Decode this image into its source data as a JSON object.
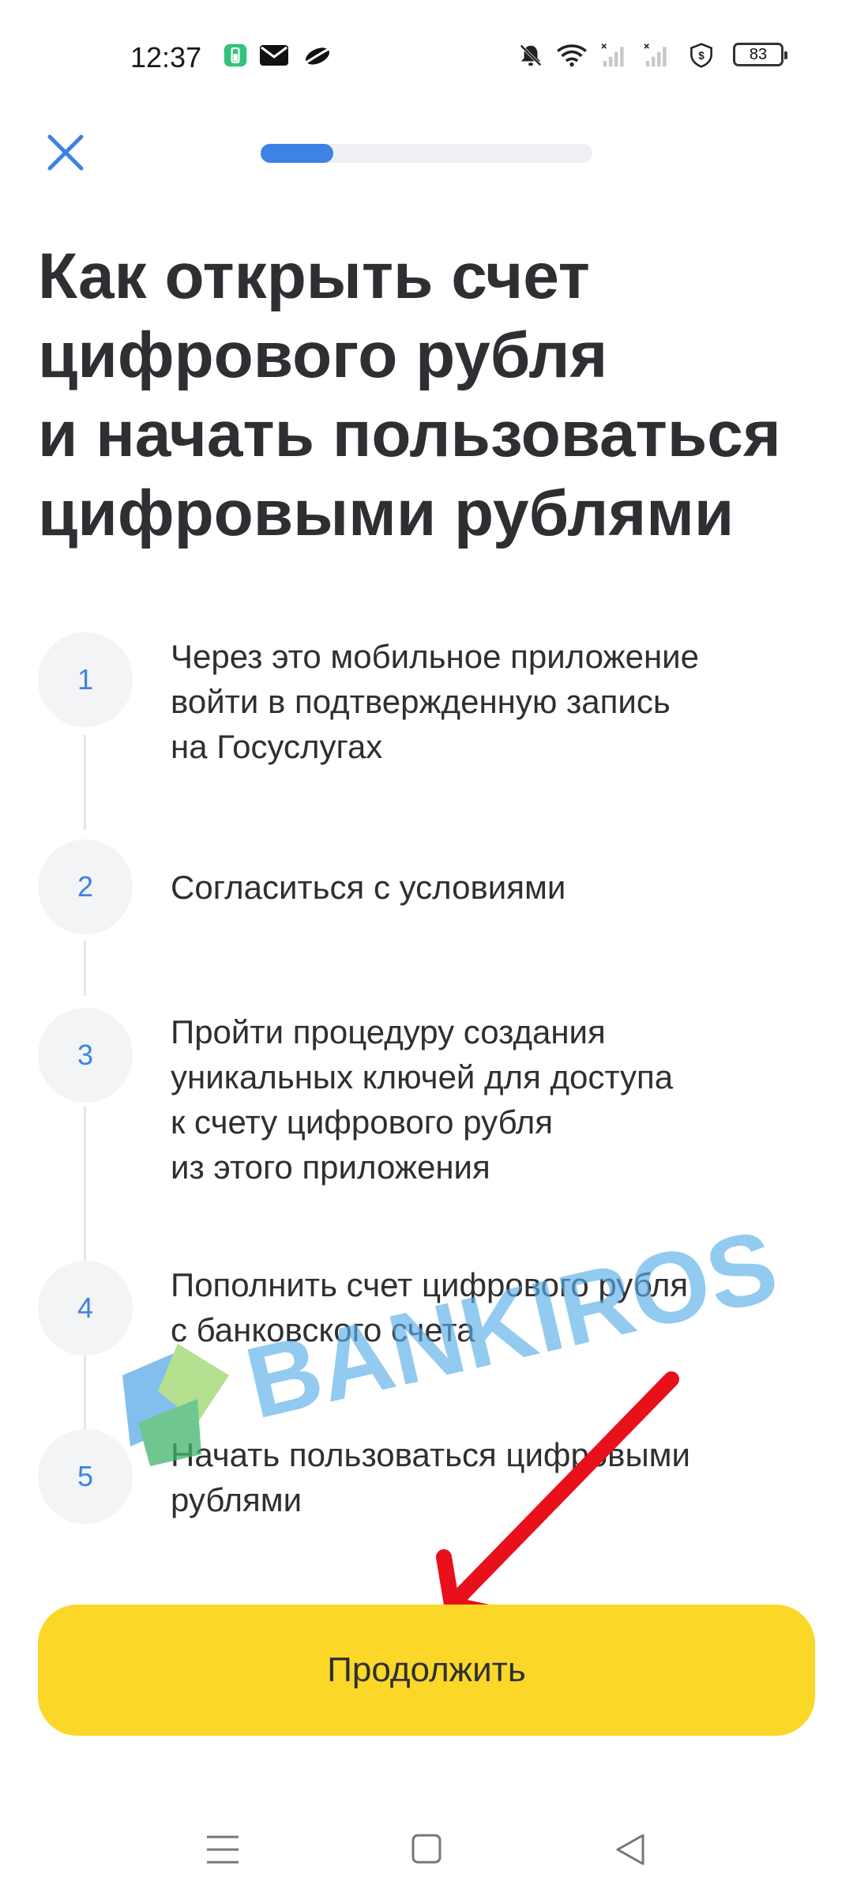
{
  "status_bar": {
    "time": "12:37",
    "battery_level": "83",
    "icons": [
      "battery-saver-icon",
      "mail-icon",
      "app-icon",
      "mute-icon",
      "wifi-icon",
      "signal-icon",
      "signal-icon",
      "shield-icon",
      "battery-icon"
    ]
  },
  "header": {
    "close_icon": "close-icon",
    "progress_fraction": 0.22,
    "accent_color": "#3d82e5"
  },
  "title": "Как открыть счет\nцифрового рубля\nи начать пользоваться\nцифровыми рублями",
  "steps": [
    {
      "number": "1",
      "text": "Через это мобильное приложение\nвойти в подтвержденную запись\nна Госуслугах"
    },
    {
      "number": "2",
      "text": "Согласиться с условиями"
    },
    {
      "number": "3",
      "text": "Пройти процедуру создания\nуникальных ключей для доступа\nк счету цифрового рубля\nиз этого приложения"
    },
    {
      "number": "4",
      "text": "Пополнить счет цифрового рубля\nс банковского счета"
    },
    {
      "number": "5",
      "text": "Начать пользоваться цифровыми\nрублями"
    }
  ],
  "watermark": {
    "text": "BANKIROS"
  },
  "continue_button": {
    "label": "Продолжить",
    "color": "#fbd728"
  },
  "nav_bar": {
    "icons": [
      "menu-icon",
      "home-icon",
      "back-icon"
    ]
  }
}
